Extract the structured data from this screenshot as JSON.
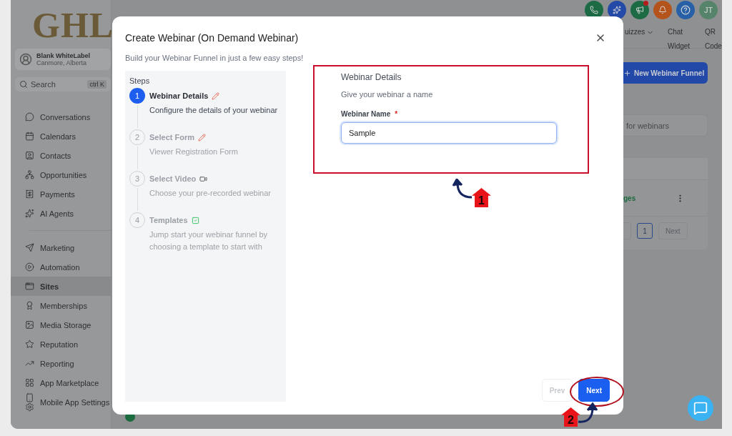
{
  "sidebar": {
    "logo": "GHL",
    "account": {
      "name": "Blank WhiteLabel",
      "location": "Canmore, Alberta"
    },
    "search": {
      "placeholder": "Search",
      "shortcut": "ctrl K"
    },
    "groups": [
      {
        "items": [
          {
            "label": "Conversations",
            "selected": false
          },
          {
            "label": "Calendars",
            "selected": false
          },
          {
            "label": "Contacts",
            "selected": false
          },
          {
            "label": "Opportunities",
            "selected": false
          },
          {
            "label": "Payments",
            "selected": false
          },
          {
            "label": "AI Agents",
            "selected": false
          }
        ]
      },
      {
        "items": [
          {
            "label": "Marketing",
            "selected": false
          },
          {
            "label": "Automation",
            "selected": false
          },
          {
            "label": "Sites",
            "selected": true
          },
          {
            "label": "Memberships",
            "selected": false
          },
          {
            "label": "Media Storage",
            "selected": false
          },
          {
            "label": "Reputation",
            "selected": false
          },
          {
            "label": "Reporting",
            "selected": false
          },
          {
            "label": "App Marketplace",
            "selected": false
          },
          {
            "label": "Mobile App Settings",
            "selected": false
          }
        ]
      }
    ]
  },
  "header": {
    "avatar": "JT",
    "tabs": [
      {
        "label": "uizzes",
        "kind": "dropdown"
      },
      {
        "label": "Chat Widget",
        "kind": "link"
      },
      {
        "label": "QR Code",
        "kind": "link"
      }
    ]
  },
  "main": {
    "new_button": "New Webinar Funnel",
    "search": {
      "placeholder": "for webinars"
    },
    "row_link": "ges",
    "pagination": {
      "pages": [
        {
          "label": "1",
          "selected": true
        }
      ],
      "next": "Next"
    }
  },
  "modal": {
    "title": "Create Webinar (On Demand Webinar)",
    "subtitle": "Build your Webinar Funnel in just a few easy steps!",
    "steps_heading": "Steps",
    "steps": [
      {
        "number": "1",
        "title": "Webinar Details",
        "description": "Configure the details of your webinar",
        "selected": true
      },
      {
        "number": "2",
        "title": "Select Form",
        "description": "Viewer Registration Form",
        "selected": false
      },
      {
        "number": "3",
        "title": "Select Video",
        "description": "Choose your pre-recorded webinar",
        "selected": false
      },
      {
        "number": "4",
        "title": "Templates",
        "description": "Jump start your webinar funnel by choosing a template to start with",
        "selected": false
      }
    ],
    "form": {
      "heading": "Webinar Details",
      "subheading": "Give your webinar a name",
      "field": {
        "label": "Webinar Name",
        "required_mark": "*",
        "value": "Sample"
      }
    },
    "buttons": [
      {
        "label": "Prev",
        "disabled": true
      },
      {
        "label": "Next",
        "disabled": false
      }
    ]
  },
  "annotations": [
    {
      "number": "1"
    },
    {
      "number": "2"
    }
  ]
}
